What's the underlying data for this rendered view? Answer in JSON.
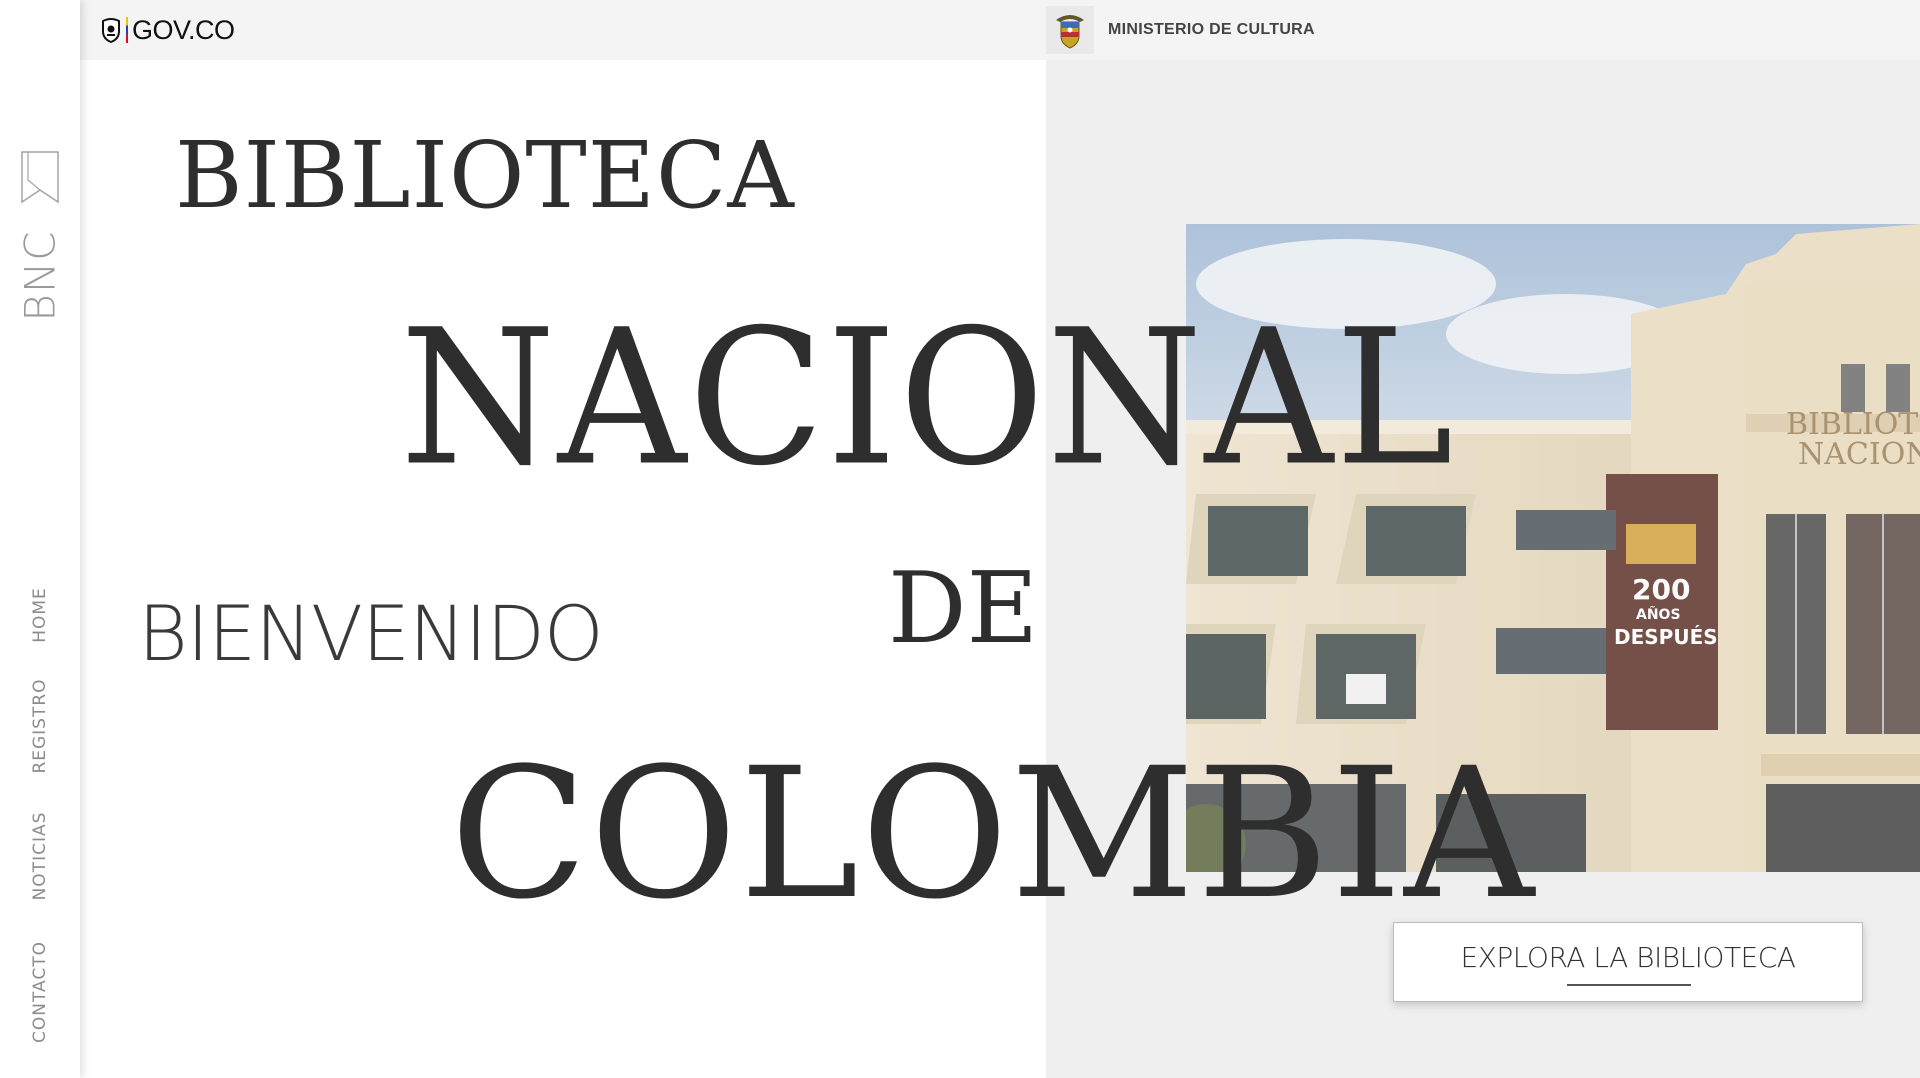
{
  "sidebar": {
    "brand": "BNC",
    "nav": [
      {
        "label": "HOME"
      },
      {
        "label": "REGISTRO"
      },
      {
        "label": "NOTICIAS"
      },
      {
        "label": "CONTACTO"
      }
    ]
  },
  "gov_bar": {
    "logo_text": "GOV.CO",
    "ministry_name": "MINISTERIO DE CULTURA"
  },
  "hero": {
    "line1": "BIBLIOTECA",
    "line2": "NACIONAL",
    "line3": "DE",
    "line4": "COLOMBIA",
    "welcome": "BIENVENIDO",
    "cta_label": "EXPLORA LA BIBLIOTECA"
  },
  "photo": {
    "building_sign": [
      "BIBLIOTECA",
      "NACIONAL"
    ],
    "banner_text": [
      "200",
      "AÑOS",
      "DESPUÉS"
    ]
  },
  "colors": {
    "text": "#2e2e2e",
    "panel": "#efefef",
    "gov_bar": "#f4f4f4"
  }
}
